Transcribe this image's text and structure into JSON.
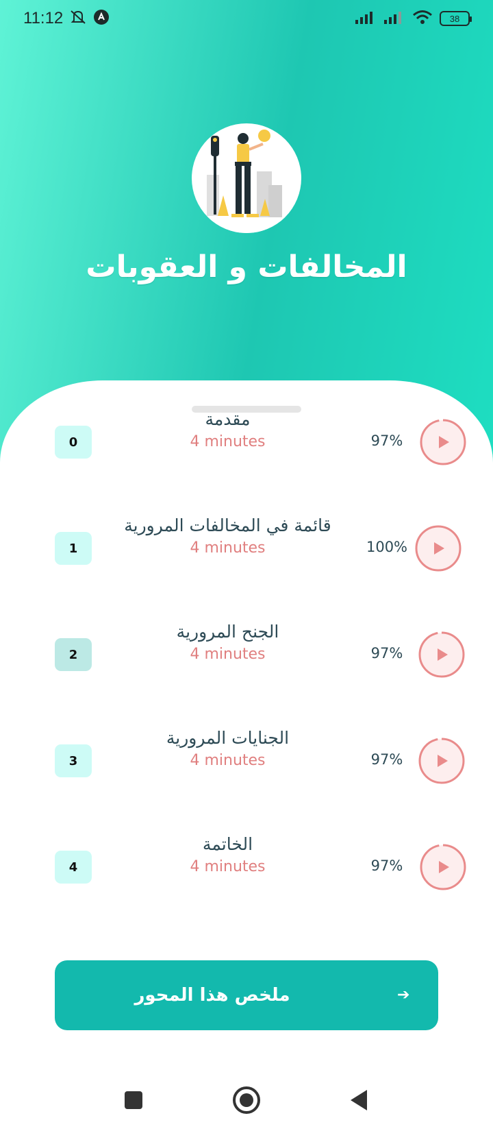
{
  "status_bar": {
    "time": "11:12",
    "battery": "38",
    "icons": [
      "mute-bell-icon",
      "app-notification-icon",
      "signal-icon",
      "signal-icon",
      "wifi-icon",
      "battery-icon"
    ]
  },
  "header": {
    "title": "المخالفات و العقوبات",
    "illustration": "traffic-officer-illustration"
  },
  "lessons": [
    {
      "index": "0",
      "title": "مقدمة",
      "duration": "4 minutes",
      "progress": "97%",
      "progress_value": 0.97,
      "active": false
    },
    {
      "index": "1",
      "title": "قائمة في المخالفات المرورية",
      "duration": "4 minutes",
      "progress": "100%",
      "progress_value": 1.0,
      "active": false
    },
    {
      "index": "2",
      "title": "الجنح المرورية",
      "duration": "4 minutes",
      "progress": "97%",
      "progress_value": 0.97,
      "active": true
    },
    {
      "index": "3",
      "title": "الجنايات المرورية",
      "duration": "4 minutes",
      "progress": "97%",
      "progress_value": 0.97,
      "active": false
    },
    {
      "index": "4",
      "title": "الخاتمة",
      "duration": "4 minutes",
      "progress": "97%",
      "progress_value": 0.97,
      "active": false
    }
  ],
  "summary_button": {
    "label": "ملخص هذا المحور",
    "icon": "arrow-right-icon"
  },
  "colors": {
    "accent": "#13b9ad",
    "play_ring": "#e98b8b",
    "play_fill": "#fdeeee",
    "duration_text": "#e07f7f"
  },
  "nav_bar": {
    "icons": [
      "recents-square-icon",
      "home-circle-icon",
      "back-triangle-icon"
    ]
  }
}
